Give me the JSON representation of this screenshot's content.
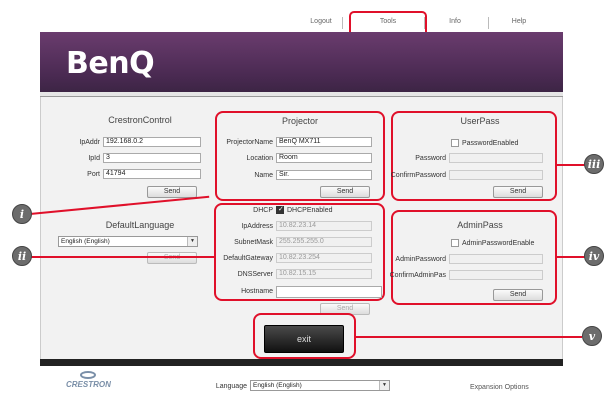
{
  "nav": {
    "logout": "Logout",
    "tools": "Tools",
    "info": "Info",
    "help": "Help"
  },
  "brand": {
    "logo_text": "BenQ"
  },
  "crestron_control": {
    "title": "CrestronControl",
    "ipaddr_label": "IpAddr",
    "ipaddr_value": "192.168.0.2",
    "ipid_label": "IpId",
    "ipid_value": "3",
    "port_label": "Port",
    "port_value": "41794",
    "send_label": "Send"
  },
  "default_language": {
    "title": "DefaultLanguage",
    "selected": "English (English)",
    "send_label": "Send"
  },
  "projector": {
    "title": "Projector",
    "name_label": "ProjectorName",
    "name_value": "BenQ MX711",
    "location_label": "Location",
    "location_value": "Room",
    "user_label": "Name",
    "user_value": "Sir.",
    "send_label": "Send"
  },
  "network": {
    "dhcp_label": "DHCP",
    "dhcp_enabled_label": "DHCPEnabled",
    "ip_label": "IpAddress",
    "ip_value": "10.82.23.14",
    "mask_label": "SubnetMask",
    "mask_value": "255.255.255.0",
    "gw_label": "DefaultGateway",
    "gw_value": "10.82.23.254",
    "dns_label": "DNSServer",
    "dns_value": "10.82.15.15",
    "host_label": "Hostname",
    "host_value": "",
    "send_label": "Send"
  },
  "user_pass": {
    "title": "UserPass",
    "enabled_label": "PasswordEnabled",
    "password_label": "Password",
    "confirm_label": "ConfirmPassword",
    "send_label": "Send"
  },
  "admin_pass": {
    "title": "AdminPass",
    "enabled_label": "AdminPasswordEnable",
    "password_label": "AdminPassword",
    "confirm_label": "ConfirmAdminPas",
    "send_label": "Send"
  },
  "exit_label": "exit",
  "footer": {
    "crestron_logo": "CRESTRON",
    "language_label": "Language",
    "language_selected": "English (English)",
    "expansion_label": "Expansion Options"
  },
  "callouts": {
    "i": "i",
    "ii": "ii",
    "iii": "iii",
    "iv": "iv",
    "v": "v"
  },
  "colors": {
    "highlight": "#e0102a",
    "banner": "#5a3462"
  }
}
